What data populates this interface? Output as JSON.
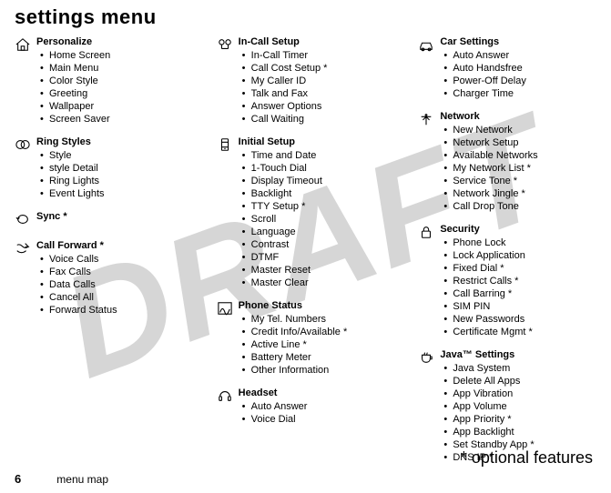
{
  "page_title": "settings menu",
  "watermark": "DRAFT",
  "footnote": "* optional features",
  "footer": {
    "page_number": "6",
    "label": "menu map"
  },
  "columns": [
    {
      "sections": [
        {
          "icon": "house-icon",
          "title": "Personalize",
          "items": [
            "Home Screen",
            "Main Menu",
            "Color Style",
            "Greeting",
            "Wallpaper",
            "Screen Saver"
          ]
        },
        {
          "icon": "rings-icon",
          "title": "Ring Styles",
          "items": [
            "Style",
            "style Detail",
            "Ring Lights",
            "Event Lights"
          ]
        },
        {
          "icon": "loop-icon",
          "title": "Sync *",
          "items": []
        },
        {
          "icon": "forward-icon",
          "title": "Call Forward *",
          "items": [
            "Voice Calls",
            "Fax Calls",
            "Data Calls",
            "Cancel All",
            "Forward Status"
          ]
        }
      ]
    },
    {
      "sections": [
        {
          "icon": "incall-icon",
          "title": "In-Call Setup",
          "items": [
            "In-Call Timer",
            "Call Cost Setup *",
            "My Caller ID",
            "Talk and Fax",
            "Answer Options",
            "Call Waiting"
          ]
        },
        {
          "icon": "setup-icon",
          "title": "Initial Setup",
          "items": [
            "Time and Date",
            "1-Touch Dial",
            "Display Timeout",
            "Backlight",
            "TTY Setup *",
            "Scroll",
            "Language",
            "Contrast",
            "DTMF",
            "Master Reset",
            "Master Clear"
          ]
        },
        {
          "icon": "status-icon",
          "title": "Phone Status",
          "items": [
            "My Tel. Numbers",
            "Credit Info/Available *",
            "Active Line *",
            "Battery Meter",
            "Other Information"
          ]
        },
        {
          "icon": "headset-icon",
          "title": "Headset",
          "items": [
            "Auto Answer",
            "Voice Dial"
          ]
        }
      ]
    },
    {
      "sections": [
        {
          "icon": "car-icon",
          "title": "Car Settings",
          "items": [
            "Auto Answer",
            "Auto Handsfree",
            "Power-Off Delay",
            "Charger Time"
          ]
        },
        {
          "icon": "network-icon",
          "title": "Network",
          "items": [
            "New Network",
            "Network Setup",
            "Available Networks",
            "My Network List *",
            "Service Tone *",
            "Network Jingle *",
            "Call Drop Tone"
          ]
        },
        {
          "icon": "lock-icon",
          "title": "Security",
          "items": [
            "Phone Lock",
            "Lock Application",
            "Fixed Dial *",
            "Restrict Calls *",
            "Call Barring *",
            "SIM PIN",
            "New Passwords",
            "Certificate Mgmt *"
          ]
        },
        {
          "icon": "java-icon",
          "title": "Java™ Settings",
          "items": [
            "Java System",
            "Delete All Apps",
            "App Vibration",
            "App Volume",
            "App Priority *",
            "App Backlight",
            "Set Standby App *",
            "DNS IP *"
          ]
        }
      ]
    }
  ]
}
